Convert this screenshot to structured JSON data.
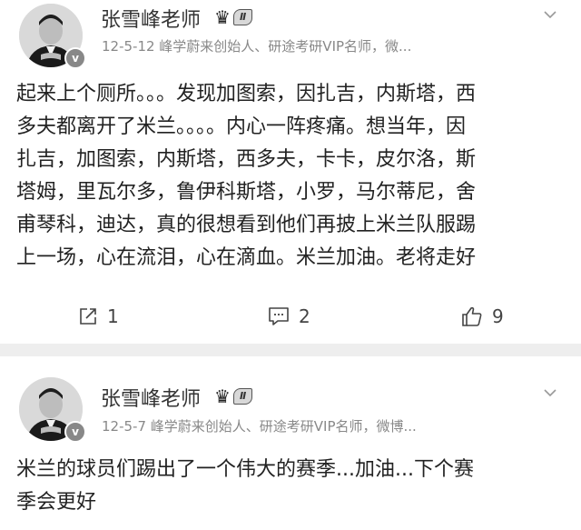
{
  "posts": [
    {
      "author": "张雪峰老师",
      "vip_level": "Ⅱ",
      "verified_mark": "v",
      "meta": "12-5-12  峰学蔚来创始人、研途考研VIP名师，微...",
      "lines": [
        "起来上个厕所。。。发现加图索，因扎吉，内斯塔，西",
        "多夫都离开了米兰。。。。内心一阵疼痛。想当年，因",
        "扎吉，加图索，内斯塔，西多夫，卡卡，皮尔洛，斯",
        "塔姆，里瓦尔多，鲁伊科斯塔，小罗，马尔蒂尼，舍",
        "甫琴科，迪达，真的很想看到他们再披上米兰队服踢",
        "上一场，心在流泪，心在滴血。米兰加油。老将走好"
      ],
      "actions": {
        "repost": {
          "icon": "repost-icon",
          "count": "1"
        },
        "comment": {
          "icon": "comment-icon",
          "count": "2"
        },
        "like": {
          "icon": "thumbs-up-icon",
          "count": "9"
        }
      }
    },
    {
      "author": "张雪峰老师",
      "vip_level": "Ⅱ",
      "verified_mark": "v",
      "meta": "12-5-7  峰学蔚来创始人、研途考研VIP名师，微博...",
      "lines": [
        "米兰的球员们踢出了一个伟大的赛季...加油...下个赛",
        "季会更好"
      ]
    }
  ]
}
